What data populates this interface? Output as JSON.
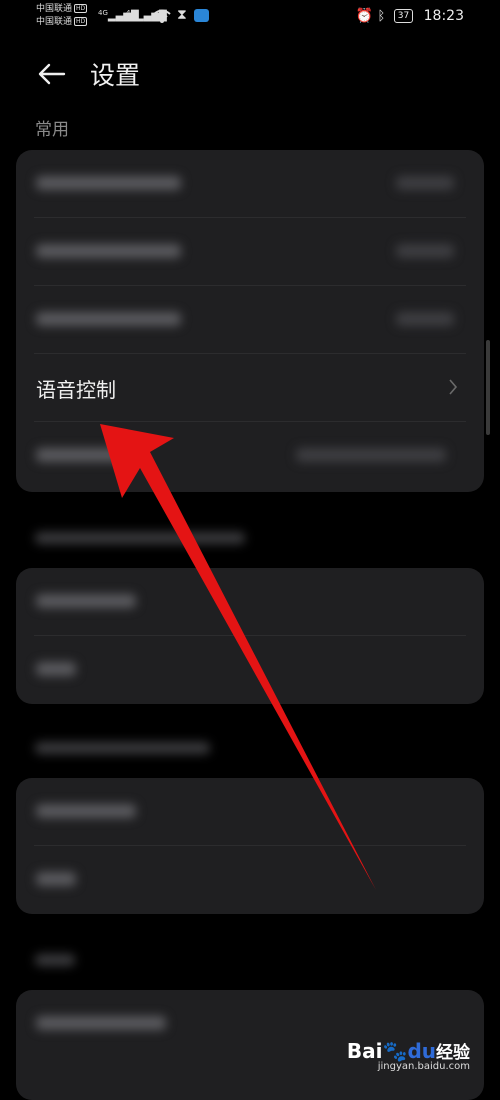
{
  "status_bar": {
    "carrier_1": "中国联通",
    "carrier_2": "中国联通",
    "hd_badge": "HD",
    "network_1": "4G",
    "network_2": "4G",
    "battery": "37",
    "time": "18:23"
  },
  "header": {
    "title": "设置"
  },
  "section": {
    "common_label": "常用"
  },
  "settings": {
    "voice_control_label": "语音控制"
  },
  "watermark": {
    "logo_part1": "Bai",
    "logo_part2": "du",
    "logo_part3": "经验",
    "url": "jingyan.baidu.com"
  }
}
